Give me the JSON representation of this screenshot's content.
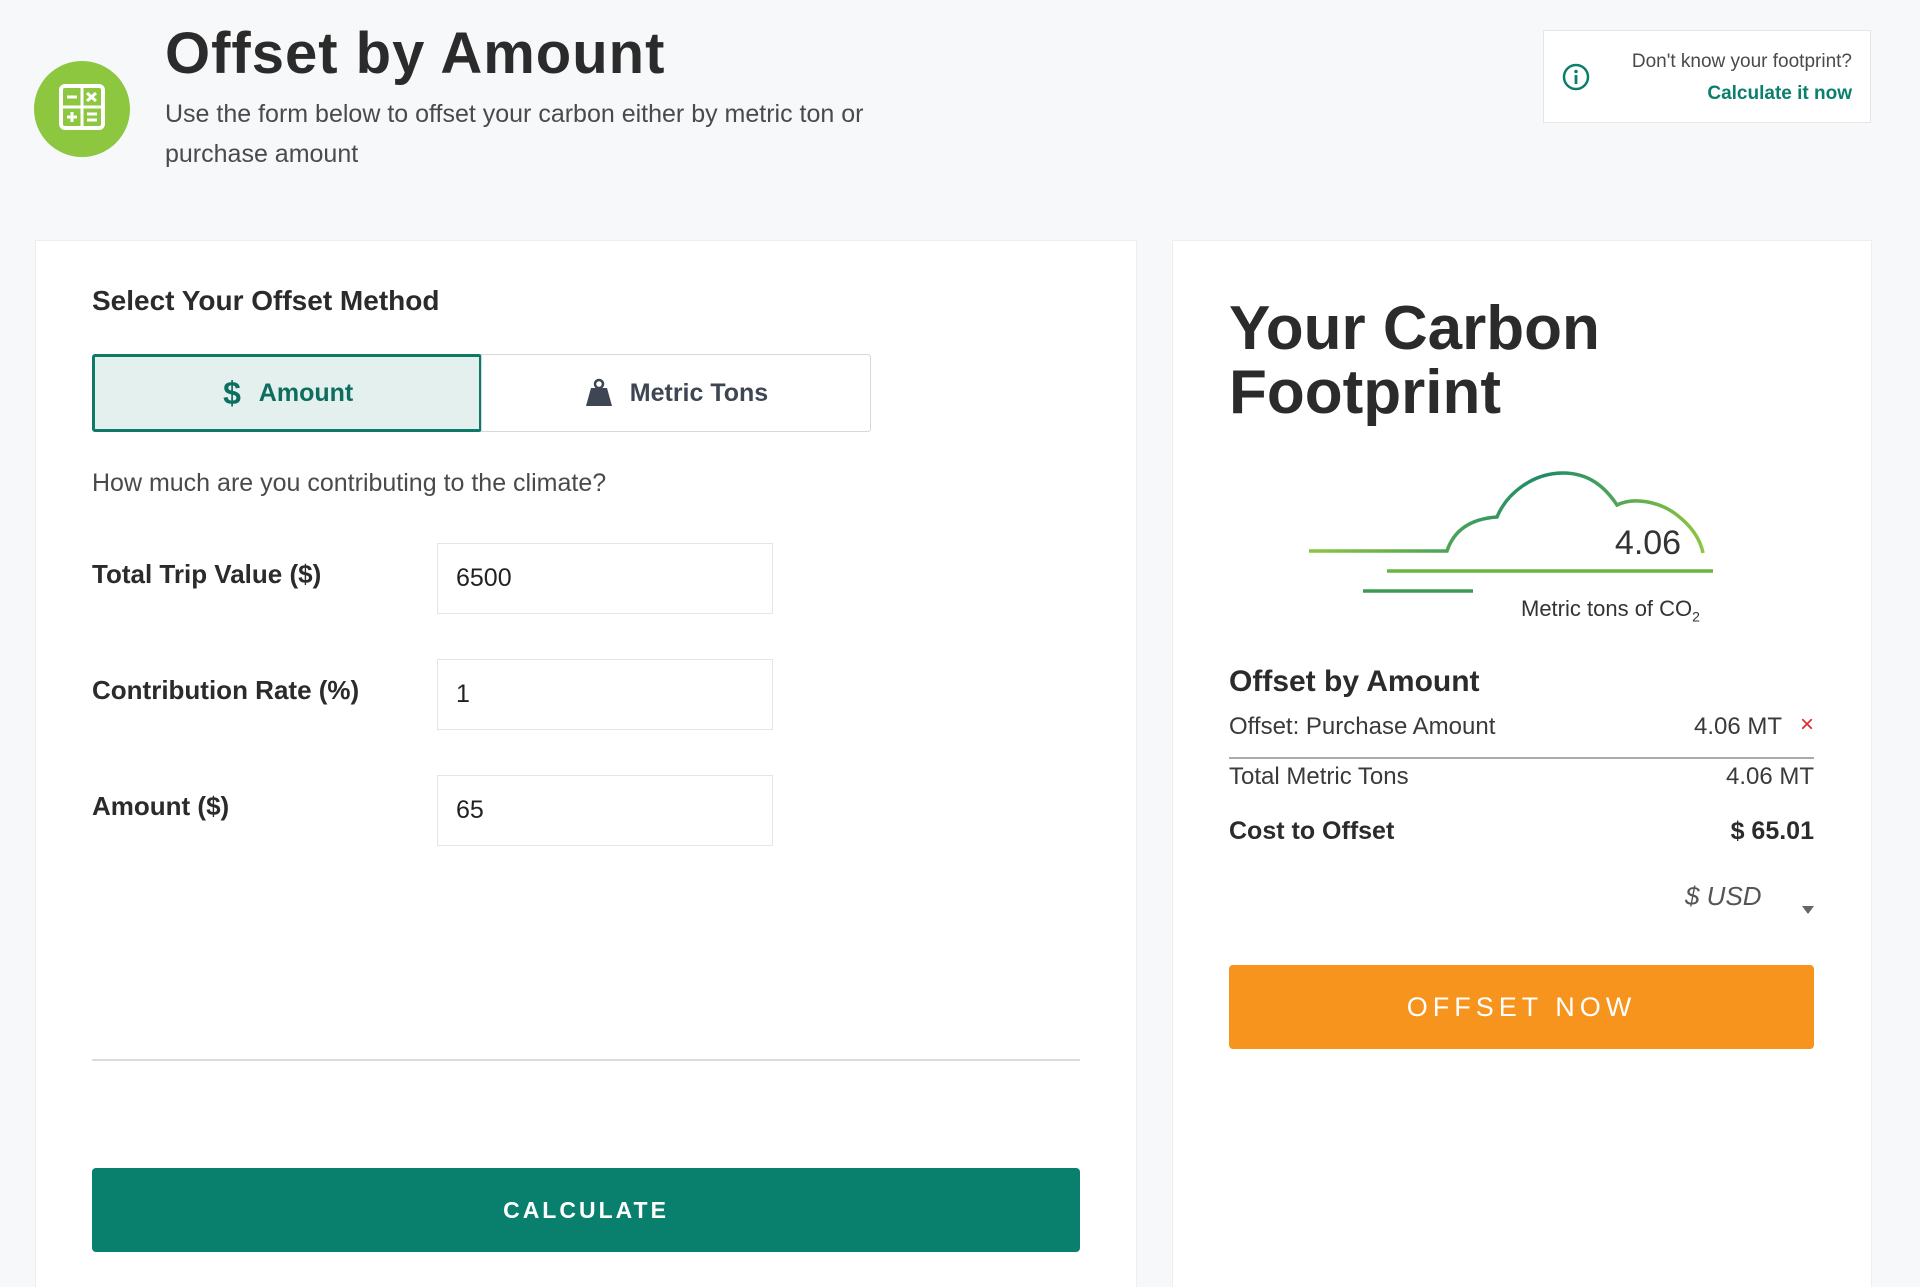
{
  "header": {
    "title": "Offset by Amount",
    "subtitle": "Use the form below to offset your carbon either by metric ton or purchase amount",
    "logo_icon": "calculator-icon",
    "logo_color": "#8dc63f"
  },
  "help": {
    "question": "Don't know your footprint?",
    "link": "Calculate it now",
    "icon": "info-icon"
  },
  "form": {
    "heading": "Select Your Offset Method",
    "methods": [
      {
        "label": "Amount",
        "icon": "dollar-icon",
        "selected": true
      },
      {
        "label": "Metric Tons",
        "icon": "weight-icon",
        "selected": false
      }
    ],
    "question": "How much are you contributing to the climate?",
    "fields": [
      {
        "label": "Total Trip Value ($)",
        "value": "6500"
      },
      {
        "label": "Contribution Rate (%)",
        "value": "1"
      },
      {
        "label": "Amount ($)",
        "value": "65"
      }
    ],
    "calculate_label": "CALCULATE",
    "accent_color": "#097f6d"
  },
  "footprint": {
    "title": "Your Carbon Footprint",
    "value": "4.06",
    "unit_caption": "Metric tons of CO",
    "unit_subscript": "2",
    "summary_heading": "Offset by Amount",
    "rows": [
      {
        "label": "Offset: Purchase Amount",
        "value": "4.06 MT",
        "removable": true
      },
      {
        "label": "Total Metric Tons",
        "value": "4.06 MT"
      },
      {
        "label": "Cost to Offset",
        "value": "$ 65.01"
      }
    ],
    "remove_symbol": "×",
    "currency": "$ USD",
    "offset_label": "OFFSET NOW",
    "offset_color": "#f7941d"
  }
}
